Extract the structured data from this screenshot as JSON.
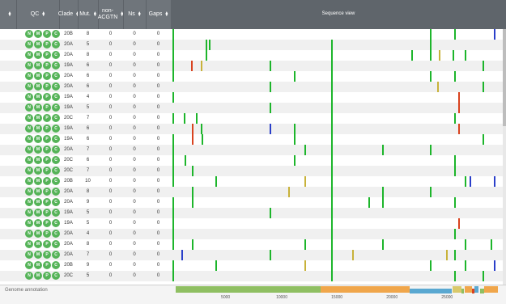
{
  "columns": {
    "qc": "QC",
    "clade": "Clade",
    "mut": "Mut.",
    "nonacgtn_line1": "non-",
    "nonacgtn_line2": "ACGTN",
    "ns": "Ns",
    "gaps": "Gaps",
    "sequence_view": "Sequence view"
  },
  "qc_badges": [
    "N",
    "M",
    "P",
    "C"
  ],
  "rows": [
    {
      "clade": "20B",
      "mut": "8",
      "nonacgtn": "0",
      "ns": "0",
      "gaps": "0"
    },
    {
      "clade": "20A",
      "mut": "5",
      "nonacgtn": "0",
      "ns": "0",
      "gaps": "0"
    },
    {
      "clade": "20A",
      "mut": "8",
      "nonacgtn": "0",
      "ns": "0",
      "gaps": "0"
    },
    {
      "clade": "19A",
      "mut": "6",
      "nonacgtn": "0",
      "ns": "0",
      "gaps": "0"
    },
    {
      "clade": "20A",
      "mut": "6",
      "nonacgtn": "0",
      "ns": "0",
      "gaps": "0"
    },
    {
      "clade": "20A",
      "mut": "6",
      "nonacgtn": "0",
      "ns": "0",
      "gaps": "0"
    },
    {
      "clade": "19A",
      "mut": "4",
      "nonacgtn": "0",
      "ns": "0",
      "gaps": "0"
    },
    {
      "clade": "19A",
      "mut": "5",
      "nonacgtn": "0",
      "ns": "0",
      "gaps": "0"
    },
    {
      "clade": "20C",
      "mut": "7",
      "nonacgtn": "0",
      "ns": "0",
      "gaps": "0"
    },
    {
      "clade": "19A",
      "mut": "6",
      "nonacgtn": "0",
      "ns": "0",
      "gaps": "0"
    },
    {
      "clade": "19A",
      "mut": "6",
      "nonacgtn": "0",
      "ns": "0",
      "gaps": "0"
    },
    {
      "clade": "20A",
      "mut": "7",
      "nonacgtn": "0",
      "ns": "0",
      "gaps": "0"
    },
    {
      "clade": "20C",
      "mut": "6",
      "nonacgtn": "0",
      "ns": "0",
      "gaps": "0"
    },
    {
      "clade": "20C",
      "mut": "7",
      "nonacgtn": "0",
      "ns": "0",
      "gaps": "0"
    },
    {
      "clade": "20B",
      "mut": "10",
      "nonacgtn": "0",
      "ns": "0",
      "gaps": "0"
    },
    {
      "clade": "20A",
      "mut": "8",
      "nonacgtn": "0",
      "ns": "0",
      "gaps": "0"
    },
    {
      "clade": "20A",
      "mut": "9",
      "nonacgtn": "0",
      "ns": "0",
      "gaps": "0"
    },
    {
      "clade": "19A",
      "mut": "5",
      "nonacgtn": "0",
      "ns": "0",
      "gaps": "0"
    },
    {
      "clade": "19A",
      "mut": "5",
      "nonacgtn": "0",
      "ns": "0",
      "gaps": "0"
    },
    {
      "clade": "20A",
      "mut": "4",
      "nonacgtn": "0",
      "ns": "0",
      "gaps": "0"
    },
    {
      "clade": "20A",
      "mut": "8",
      "nonacgtn": "0",
      "ns": "0",
      "gaps": "0"
    },
    {
      "clade": "20A",
      "mut": "7",
      "nonacgtn": "0",
      "ns": "0",
      "gaps": "0"
    },
    {
      "clade": "20B",
      "mut": "9",
      "nonacgtn": "0",
      "ns": "0",
      "gaps": "0"
    },
    {
      "clade": "20C",
      "mut": "5",
      "nonacgtn": "0",
      "ns": "0",
      "gaps": "0"
    }
  ],
  "mutations": [
    [
      [
        1,
        "g"
      ],
      [
        27,
        "g"
      ],
      [
        23400,
        "g"
      ],
      [
        25560,
        "g"
      ],
      [
        29200,
        "b"
      ]
    ],
    [
      [
        1,
        "g"
      ],
      [
        2990,
        "g"
      ],
      [
        3270,
        "g"
      ],
      [
        14400,
        "g"
      ],
      [
        23400,
        "g"
      ]
    ],
    [
      [
        1,
        "g"
      ],
      [
        2990,
        "g"
      ],
      [
        14400,
        "g"
      ],
      [
        21700,
        "g"
      ],
      [
        23400,
        "g"
      ],
      [
        24200,
        "y"
      ],
      [
        25400,
        "g"
      ],
      [
        26500,
        "g"
      ]
    ],
    [
      [
        1,
        "g"
      ],
      [
        1700,
        "r"
      ],
      [
        2600,
        "y"
      ],
      [
        8782,
        "g"
      ],
      [
        14400,
        "g"
      ],
      [
        28144,
        "g"
      ]
    ],
    [
      [
        1,
        "g"
      ],
      [
        11000,
        "g"
      ],
      [
        14400,
        "g"
      ],
      [
        23400,
        "g"
      ],
      [
        25600,
        "g"
      ]
    ],
    [
      [
        8782,
        "g"
      ],
      [
        14400,
        "g"
      ],
      [
        24000,
        "y"
      ],
      [
        28144,
        "g"
      ]
    ],
    [
      [
        1,
        "g"
      ],
      [
        14400,
        "g"
      ],
      [
        25900,
        "r"
      ]
    ],
    [
      [
        8782,
        "g"
      ],
      [
        14400,
        "g"
      ],
      [
        25900,
        "r"
      ]
    ],
    [
      [
        1,
        "g"
      ],
      [
        1000,
        "g"
      ],
      [
        2100,
        "g"
      ],
      [
        14400,
        "g"
      ],
      [
        25600,
        "g"
      ]
    ],
    [
      [
        1800,
        "r"
      ],
      [
        2600,
        "g"
      ],
      [
        8782,
        "b"
      ],
      [
        11000,
        "g"
      ],
      [
        14400,
        "g"
      ],
      [
        25900,
        "r"
      ]
    ],
    [
      [
        1,
        "g"
      ],
      [
        1800,
        "r"
      ],
      [
        2650,
        "g"
      ],
      [
        11000,
        "g"
      ],
      [
        14400,
        "g"
      ],
      [
        28144,
        "g"
      ]
    ],
    [
      [
        1,
        "g"
      ],
      [
        14400,
        "g"
      ],
      [
        12000,
        "g"
      ],
      [
        19000,
        "g"
      ],
      [
        23400,
        "g"
      ]
    ],
    [
      [
        1,
        "g"
      ],
      [
        1100,
        "g"
      ],
      [
        11000,
        "g"
      ],
      [
        14400,
        "g"
      ],
      [
        25600,
        "g"
      ]
    ],
    [
      [
        1,
        "g"
      ],
      [
        1800,
        "g"
      ],
      [
        14400,
        "g"
      ],
      [
        25600,
        "g"
      ]
    ],
    [
      [
        1,
        "g"
      ],
      [
        3900,
        "g"
      ],
      [
        12000,
        "y"
      ],
      [
        14400,
        "g"
      ],
      [
        26500,
        "g"
      ],
      [
        27000,
        "b"
      ],
      [
        29200,
        "b"
      ]
    ],
    [
      [
        1800,
        "g"
      ],
      [
        10500,
        "y"
      ],
      [
        14400,
        "g"
      ],
      [
        19000,
        "g"
      ],
      [
        23400,
        "g"
      ]
    ],
    [
      [
        1,
        "g"
      ],
      [
        1800,
        "g"
      ],
      [
        14400,
        "g"
      ],
      [
        17800,
        "g"
      ],
      [
        19000,
        "g"
      ],
      [
        25600,
        "g"
      ]
    ],
    [
      [
        1,
        "g"
      ],
      [
        8782,
        "g"
      ],
      [
        14400,
        "g"
      ]
    ],
    [
      [
        1,
        "g"
      ],
      [
        14400,
        "g"
      ],
      [
        25900,
        "r"
      ]
    ],
    [
      [
        1,
        "g"
      ],
      [
        14400,
        "g"
      ],
      [
        25600,
        "g"
      ]
    ],
    [
      [
        1,
        "g"
      ],
      [
        1800,
        "g"
      ],
      [
        12000,
        "g"
      ],
      [
        14400,
        "g"
      ],
      [
        19000,
        "g"
      ],
      [
        26500,
        "g"
      ],
      [
        28900,
        "g"
      ]
    ],
    [
      [
        800,
        "b"
      ],
      [
        8782,
        "g"
      ],
      [
        14400,
        "g"
      ],
      [
        16300,
        "y"
      ],
      [
        25600,
        "g"
      ],
      [
        24800,
        "y"
      ]
    ],
    [
      [
        1,
        "g"
      ],
      [
        3900,
        "g"
      ],
      [
        12000,
        "y"
      ],
      [
        14400,
        "g"
      ],
      [
        23400,
        "g"
      ],
      [
        26500,
        "g"
      ],
      [
        29200,
        "b"
      ]
    ],
    [
      [
        1,
        "g"
      ],
      [
        14400,
        "g"
      ],
      [
        25600,
        "g"
      ],
      [
        28144,
        "g"
      ]
    ]
  ],
  "colors": {
    "g": "#1db52b",
    "b": "#2a3fc9",
    "r": "#d9431f",
    "y": "#c8b23a",
    "qc": "#55b358"
  },
  "genome": {
    "label": "Genome annotation",
    "length": 29903,
    "ticks": [
      "5000",
      "10000",
      "15000",
      "20000",
      "25000"
    ],
    "tick_values": [
      5000,
      10000,
      15000,
      20000,
      25000
    ],
    "genes": [
      {
        "start": 266,
        "end": 13468,
        "color": "#8fbf62",
        "lane": 0
      },
      {
        "start": 13468,
        "end": 21555,
        "color": "#f0a64b",
        "lane": 0
      },
      {
        "start": 21563,
        "end": 25384,
        "color": "#5aa8d1",
        "lane": 1
      },
      {
        "start": 25393,
        "end": 26220,
        "color": "#d9c96b",
        "lane": 0
      },
      {
        "start": 26245,
        "end": 26472,
        "color": "#8fbf62",
        "lane": 1
      },
      {
        "start": 26523,
        "end": 27191,
        "color": "#f0a64b",
        "lane": 0
      },
      {
        "start": 27202,
        "end": 27387,
        "color": "#d9431f",
        "lane": 1
      },
      {
        "start": 27394,
        "end": 27759,
        "color": "#5aa8d1",
        "lane": 0
      },
      {
        "start": 27894,
        "end": 28259,
        "color": "#8fbf62",
        "lane": 1
      },
      {
        "start": 28274,
        "end": 29533,
        "color": "#f0a64b",
        "lane": 0
      }
    ]
  }
}
